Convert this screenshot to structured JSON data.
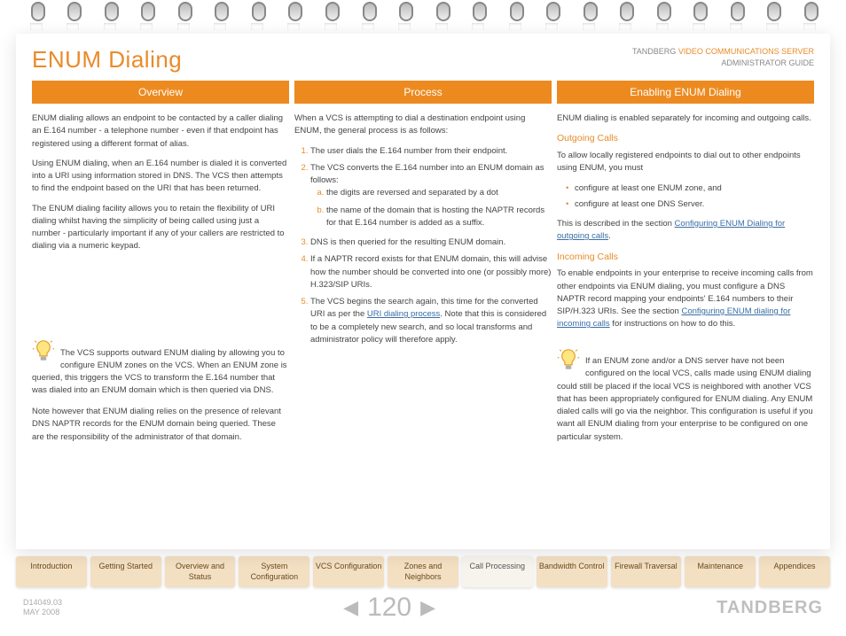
{
  "meta": {
    "brand_line": "TANDBERG",
    "product_line": "VIDEO COMMUNICATIONS SERVER",
    "guide_line": "ADMINISTRATOR GUIDE"
  },
  "title": "ENUM Dialing",
  "columns": {
    "overview": {
      "header": "Overview",
      "p1": "ENUM dialing allows an endpoint to be contacted by a caller dialing an E.164 number - a telephone number - even if that endpoint has registered using a different format of alias.",
      "p2": "Using ENUM dialing, when an E.164 number is dialed it is converted into a URI using information stored in DNS.  The VCS then attempts to find the endpoint based on the URI that has been returned.",
      "p3": "The ENUM dialing facility allows you to retain the flexibility of URI dialing whilst having the simplicity of being called using just a number - particularly important if any of your callers are restricted to dialing via a numeric keypad.",
      "tip_p1": "The VCS supports outward ENUM dialing by allowing you to configure ENUM zones on the VCS.  When an ENUM zone is queried, this triggers the VCS to transform the E.164 number that was dialed into an ENUM domain which is then queried via DNS.",
      "tip_p2": "Note however that ENUM dialing relies on the presence of relevant DNS NAPTR records for the ENUM domain being queried.  These are the responsibility of the administrator of that domain."
    },
    "process": {
      "header": "Process",
      "intro": "When a VCS is attempting to dial a destination endpoint using ENUM, the general process is as follows:",
      "step1": "The user dials the E.164 number from their endpoint.",
      "step2": "The VCS converts the E.164 number into an ENUM domain as follows:",
      "step2a": "the digits are reversed and separated by a dot",
      "step2b": "the name of the domain that is hosting the NAPTR records for that E.164 number is added as a suffix.",
      "step3": "DNS is then queried for the resulting ENUM domain.",
      "step4": "If a NAPTR record exists for that ENUM domain, this will advise how the number should be converted into one (or possibly more) H.323/SIP URIs.",
      "step5_a": "The VCS begins the search again, this time for the converted URI as per the ",
      "step5_link": "URI dialing process",
      "step5_b": ".  Note that this is considered to be a completely new search, and so local transforms and administrator policy will therefore apply."
    },
    "enabling": {
      "header": "Enabling ENUM Dialing",
      "intro": "ENUM dialing is enabled separately for incoming and outgoing calls.",
      "out_h": "Outgoing Calls",
      "out_p": "To allow locally registered endpoints to dial out to other endpoints using ENUM, you must",
      "out_b1": "configure at least one ENUM zone, and",
      "out_b2": "configure at least one DNS Server.",
      "out_desc_a": "This is described in the section  ",
      "out_link": "Configuring ENUM Dialing for outgoing calls",
      "out_desc_b": ".",
      "in_h": "Incoming Calls",
      "in_p_a": "To enable endpoints in your enterprise to receive incoming calls from other endpoints via ENUM dialing, you must configure a DNS NAPTR record mapping your endpoints' E.164 numbers to their SIP/H.323 URIs.  See the section ",
      "in_link": "Configuring ENUM dialing for incoming calls",
      "in_p_b": " for instructions on how to do this.",
      "tip": "If an ENUM zone and/or a DNS server have not been configured on the local VCS, calls made using ENUM dialing could still be placed if the local VCS is neighbored with another VCS that has been appropriately configured for ENUM dialing. Any ENUM dialed calls will go via the neighbor. This configuration is useful if you want all ENUM dialing from your enterprise to be configured on one particular system."
    }
  },
  "tabs": [
    {
      "label": "Introduction"
    },
    {
      "label": "Getting Started"
    },
    {
      "label": "Overview and Status"
    },
    {
      "label": "System Configuration"
    },
    {
      "label": "VCS Configuration"
    },
    {
      "label": "Zones and Neighbors"
    },
    {
      "label": "Call Processing",
      "active": true
    },
    {
      "label": "Bandwidth Control"
    },
    {
      "label": "Firewall Traversal"
    },
    {
      "label": "Maintenance"
    },
    {
      "label": "Appendices"
    }
  ],
  "footer": {
    "doc_id": "D14049.03",
    "date": "MAY 2008",
    "page": "120",
    "brand": "TANDBERG"
  }
}
